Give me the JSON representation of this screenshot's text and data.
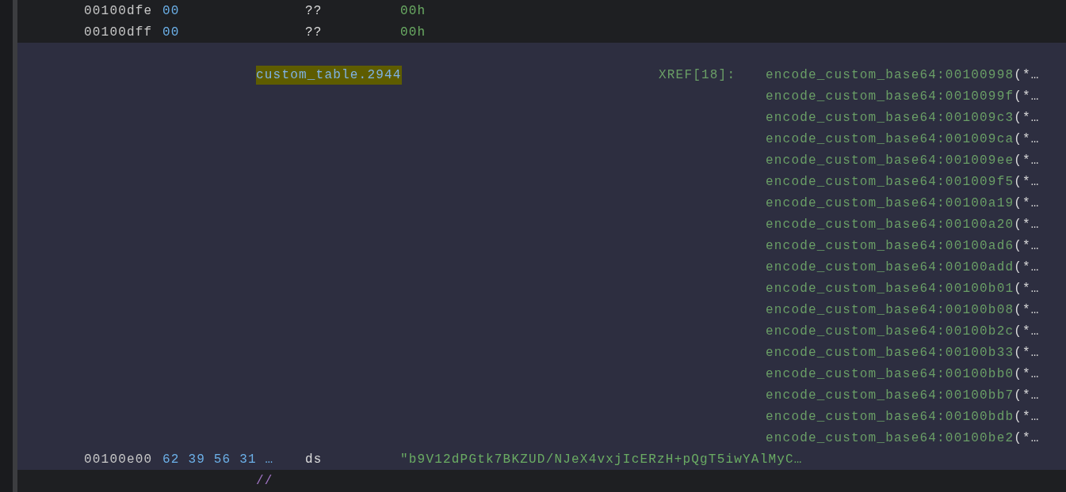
{
  "listing": {
    "rows": [
      {
        "kind": "instruction",
        "selected": false,
        "address": "00100dfe",
        "bytes": "00",
        "mnemonic": "??",
        "operand": "00h"
      },
      {
        "kind": "instruction",
        "selected": false,
        "address": "00100dff",
        "bytes": "00",
        "mnemonic": "??",
        "operand": "00h"
      },
      {
        "kind": "label",
        "selected": true,
        "label": "custom_table.2944",
        "xref_label": "XREF[18]:",
        "xrefs": [
          {
            "ref": "encode_custom_base64:00100998",
            "suffix": "(*…"
          },
          {
            "ref": "encode_custom_base64:0010099f",
            "suffix": "(*…"
          },
          {
            "ref": "encode_custom_base64:001009c3",
            "suffix": "(*…"
          },
          {
            "ref": "encode_custom_base64:001009ca",
            "suffix": "(*…"
          },
          {
            "ref": "encode_custom_base64:001009ee",
            "suffix": "(*…"
          },
          {
            "ref": "encode_custom_base64:001009f5",
            "suffix": "(*…"
          },
          {
            "ref": "encode_custom_base64:00100a19",
            "suffix": "(*…"
          },
          {
            "ref": "encode_custom_base64:00100a20",
            "suffix": "(*…"
          },
          {
            "ref": "encode_custom_base64:00100ad6",
            "suffix": "(*…"
          },
          {
            "ref": "encode_custom_base64:00100add",
            "suffix": "(*…"
          },
          {
            "ref": "encode_custom_base64:00100b01",
            "suffix": "(*…"
          },
          {
            "ref": "encode_custom_base64:00100b08",
            "suffix": "(*…"
          },
          {
            "ref": "encode_custom_base64:00100b2c",
            "suffix": "(*…"
          },
          {
            "ref": "encode_custom_base64:00100b33",
            "suffix": "(*…"
          },
          {
            "ref": "encode_custom_base64:00100bb0",
            "suffix": "(*…"
          },
          {
            "ref": "encode_custom_base64:00100bb7",
            "suffix": "(*…"
          },
          {
            "ref": "encode_custom_base64:00100bdb",
            "suffix": "(*…"
          },
          {
            "ref": "encode_custom_base64:00100be2",
            "suffix": "(*…"
          }
        ]
      },
      {
        "kind": "instruction",
        "selected": true,
        "address": "00100e00",
        "bytes": "62 39 56 31 …",
        "mnemonic": "ds",
        "operand": "\"b9V12dPGtk7BKZUD/NJeX4vxjIcERzH+pQgT5iwYAlMyC…"
      },
      {
        "kind": "comment",
        "selected": false,
        "text": "//"
      }
    ]
  }
}
